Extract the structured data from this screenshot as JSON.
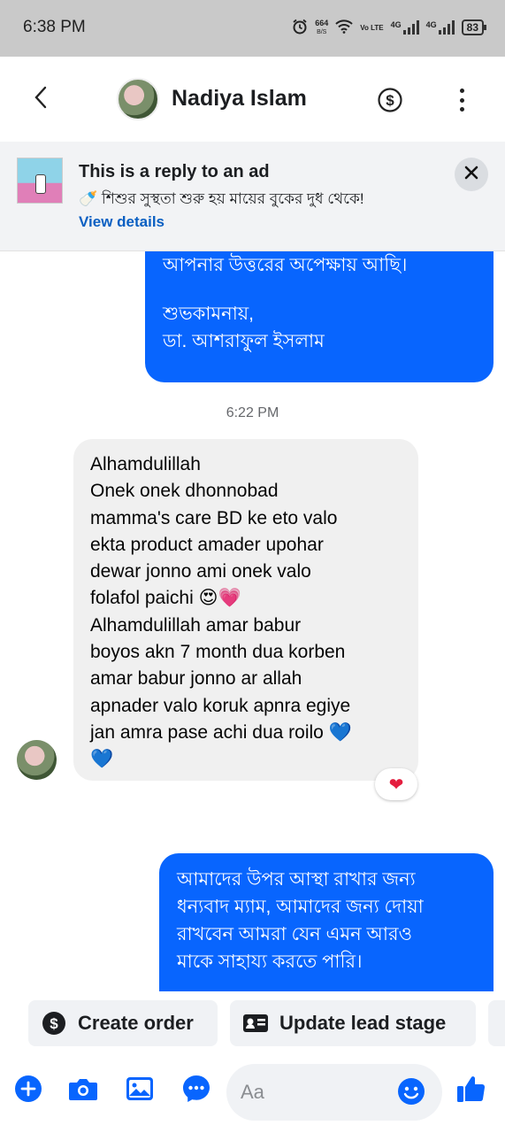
{
  "status_bar": {
    "time": "6:38 PM",
    "network_speed_value": "664",
    "network_speed_unit": "B/S",
    "volte_label": "Vo LTE",
    "network_1": "4G",
    "network_2": "4G",
    "battery": "83"
  },
  "header": {
    "contact_name": "Nadiya Islam",
    "back_icon": "chevron-left-icon",
    "dollar_icon": "dollar-circle-icon",
    "more_icon": "more-vertical-icon"
  },
  "ad_banner": {
    "title": "This is a reply to an ad",
    "description": "🍼 শিশুর সুস্থতা শুরু হয় মায়ের বুকের দুধ থেকে!",
    "link": "View details",
    "close_icon": "close-icon"
  },
  "messages": {
    "outgoing_1": {
      "lines": [
        "আপনার উত্তরের অপেক্ষায় আছি।",
        "শুভকামনায়,",
        "ডা. আশরাফুল ইসলাম"
      ]
    },
    "timestamp": "6:22 PM",
    "incoming_1": {
      "lines": [
        "Alhamdulillah",
        "Onek onek dhonnobad",
        "mamma's care BD ke eto valo",
        "ekta product amader upohar",
        "dewar jonno ami onek valo",
        "folafol paichi 😍💗",
        "Alhamdulillah amar babur",
        "boyos akn 7 month dua korben",
        "amar babur jonno ar allah",
        "apnader valo koruk apnra egiye",
        "jan amra pase achi dua roilo 💙",
        "💙"
      ],
      "reaction": "❤"
    },
    "outgoing_2": {
      "lines": [
        "আমাদের উপর আস্থা রাখার জন্য",
        "ধন্যবাদ ম্যাম, আমাদের জন্য দোয়া",
        "রাখবেন আমরা যেন এমন আরও",
        "মাকে সাহায্য করতে পারি।"
      ]
    }
  },
  "quick_actions": {
    "create_order": "Create order",
    "update_lead_stage": "Update lead stage"
  },
  "composer": {
    "placeholder": "Aa",
    "icons": [
      "plus-icon",
      "camera-icon",
      "gallery-icon",
      "chat-bubble-icon",
      "smile-icon",
      "thumbs-up-icon"
    ]
  },
  "colors": {
    "accent": "#0865fe",
    "incoming_bubble": "#f0f0f0",
    "status_bar": "#c9c9c9",
    "link": "#0a5fc2"
  }
}
